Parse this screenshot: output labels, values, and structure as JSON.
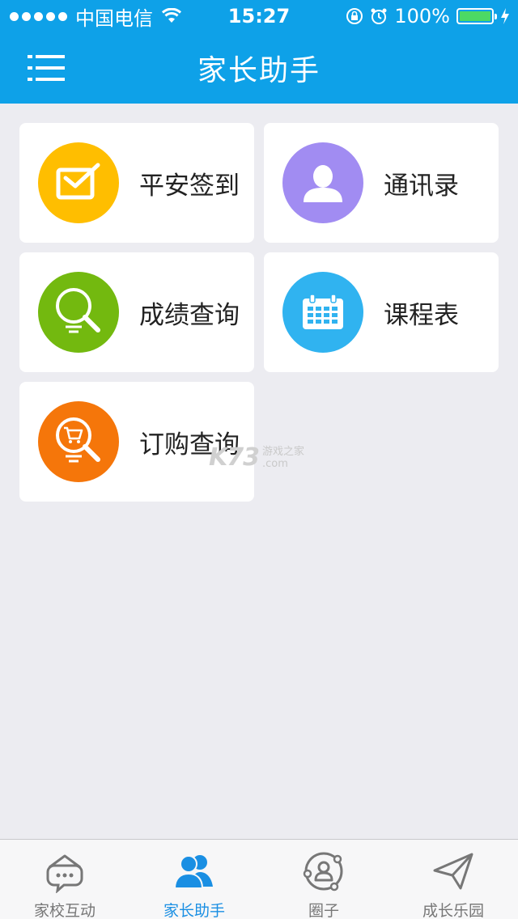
{
  "status_bar": {
    "carrier": "中国电信",
    "time": "15:27",
    "battery": "100%"
  },
  "nav": {
    "title": "家长助手"
  },
  "tiles": [
    {
      "label": "平安签到",
      "icon": "check-in-icon",
      "color": "#ffbe00"
    },
    {
      "label": "通讯录",
      "icon": "contact-person-icon",
      "color": "#a18cf2"
    },
    {
      "label": "成绩查询",
      "icon": "grade-search-icon",
      "color": "#73b90f"
    },
    {
      "label": "课程表",
      "icon": "calendar-icon",
      "color": "#30b3f0"
    },
    {
      "label": "订购查询",
      "icon": "order-search-icon",
      "color": "#f5760a"
    }
  ],
  "watermark": {
    "logo": "K73",
    "line1": "游戏之家",
    "line2": ".com"
  },
  "tab_bar": {
    "items": [
      {
        "label": "家校互动",
        "icon": "chat-bubble-icon",
        "active": false
      },
      {
        "label": "家长助手",
        "icon": "parents-icon",
        "active": true
      },
      {
        "label": "圈子",
        "icon": "circle-person-icon",
        "active": false
      },
      {
        "label": "成长乐园",
        "icon": "paper-plane-icon",
        "active": false
      }
    ]
  },
  "colors": {
    "primary": "#0ea1e8",
    "background": "#ececf1",
    "tab_active": "#1a8fe3"
  }
}
